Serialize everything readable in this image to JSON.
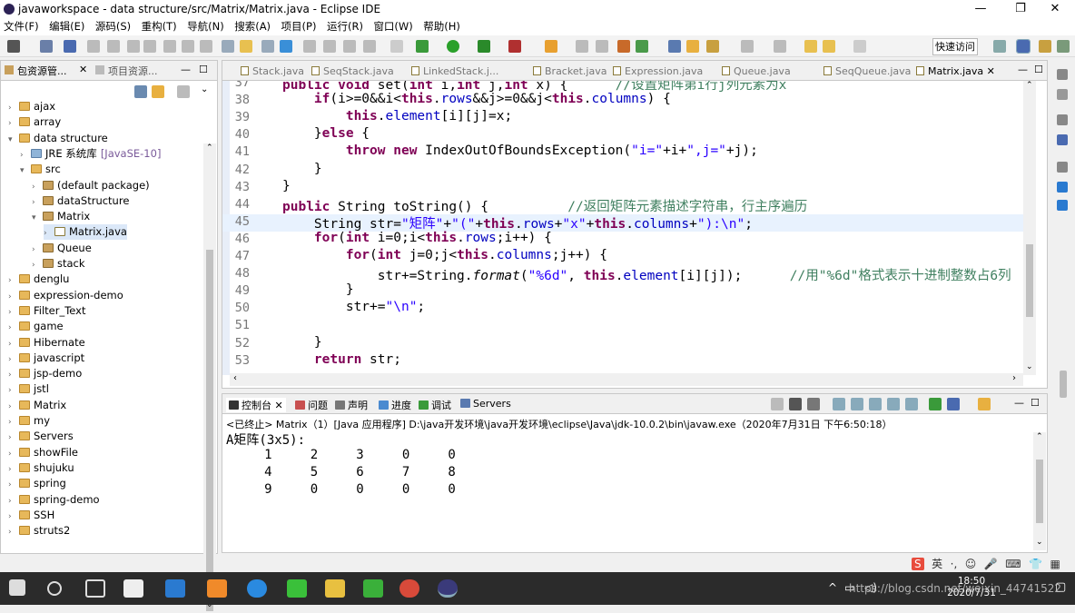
{
  "window": {
    "title": "javaworkspace - data structure/src/Matrix/Matrix.java - Eclipse IDE"
  },
  "menu": [
    "文件(F)",
    "编辑(E)",
    "源码(S)",
    "重构(T)",
    "导航(N)",
    "搜索(A)",
    "项目(P)",
    "运行(R)",
    "窗口(W)",
    "帮助(H)"
  ],
  "toolbar": {
    "quick_access": "快速访问"
  },
  "left_panel": {
    "tabs": [
      "包资源管...",
      "项目资源..."
    ],
    "tree": [
      {
        "label": "ajax",
        "type": "folder",
        "level": 0,
        "arrow": ">"
      },
      {
        "label": "array",
        "type": "folder",
        "level": 0,
        "arrow": ">"
      },
      {
        "label": "data structure",
        "type": "folder",
        "level": 0,
        "arrow": "v"
      },
      {
        "label": "JRE 系统库",
        "suffix": "[JavaSE-10]",
        "type": "lib",
        "level": 1,
        "arrow": ">"
      },
      {
        "label": "src",
        "type": "folder",
        "level": 1,
        "arrow": "v"
      },
      {
        "label": "(default package)",
        "type": "pkg",
        "level": 2,
        "arrow": ">"
      },
      {
        "label": "dataStructure",
        "type": "pkg",
        "level": 2,
        "arrow": ">"
      },
      {
        "label": "Matrix",
        "type": "pkg",
        "level": 2,
        "arrow": "v"
      },
      {
        "label": "Matrix.java",
        "type": "java",
        "level": 3,
        "arrow": ">"
      },
      {
        "label": "Queue",
        "type": "pkg",
        "level": 2,
        "arrow": ">"
      },
      {
        "label": "stack",
        "type": "pkg",
        "level": 2,
        "arrow": ">"
      },
      {
        "label": "denglu",
        "type": "folder",
        "level": 0,
        "arrow": ">"
      },
      {
        "label": "expression-demo",
        "type": "folder",
        "level": 0,
        "arrow": ">"
      },
      {
        "label": "Filter_Text",
        "type": "folder",
        "level": 0,
        "arrow": ">"
      },
      {
        "label": "game",
        "type": "folder",
        "level": 0,
        "arrow": ">"
      },
      {
        "label": "Hibernate",
        "type": "folder",
        "level": 0,
        "arrow": ">"
      },
      {
        "label": "javascript",
        "type": "folder",
        "level": 0,
        "arrow": ">"
      },
      {
        "label": "jsp-demo",
        "type": "folder",
        "level": 0,
        "arrow": ">"
      },
      {
        "label": "jstl",
        "type": "folder",
        "level": 0,
        "arrow": ">"
      },
      {
        "label": "Matrix",
        "type": "folder",
        "level": 0,
        "arrow": ">"
      },
      {
        "label": "my",
        "type": "folder",
        "level": 0,
        "arrow": ">"
      },
      {
        "label": "Servers",
        "type": "folder",
        "level": 0,
        "arrow": ">"
      },
      {
        "label": "showFile",
        "type": "folder",
        "level": 0,
        "arrow": ">"
      },
      {
        "label": "shujuku",
        "type": "folder",
        "level": 0,
        "arrow": ">"
      },
      {
        "label": "spring",
        "type": "folder",
        "level": 0,
        "arrow": ">"
      },
      {
        "label": "spring-demo",
        "type": "folder",
        "level": 0,
        "arrow": ">"
      },
      {
        "label": "SSH",
        "type": "folder",
        "level": 0,
        "arrow": ">"
      },
      {
        "label": "struts2",
        "type": "folder",
        "level": 0,
        "arrow": ">"
      }
    ]
  },
  "editor": {
    "tabs": [
      "Stack.java",
      "SeqStack.java",
      "LinkedStack.j...",
      "Bracket.java",
      "Expression.java",
      "Queue.java",
      "SeqQueue.java",
      "Matrix.java"
    ],
    "active_tab": "Matrix.java",
    "lines": [
      {
        "n": "37",
        "code": [
          [
            "kw",
            "public "
          ],
          [
            "kw",
            "void "
          ],
          [
            "",
            "set("
          ],
          [
            "kw",
            "int "
          ],
          [
            "",
            "i,"
          ],
          [
            "kw",
            "int "
          ],
          [
            "",
            "j,"
          ],
          [
            "kw",
            "int "
          ],
          [
            "",
            "x) {      "
          ],
          [
            "cm",
            "//设置矩阵第i行j列元素为x"
          ]
        ]
      },
      {
        "n": "38",
        "code": [
          [
            "",
            "    "
          ],
          [
            "kw",
            "if"
          ],
          [
            "",
            "(i>=0&&i<"
          ],
          [
            "kw",
            "this"
          ],
          [
            "",
            "."
          ],
          [
            "fld",
            "rows"
          ],
          [
            "",
            "&&j>=0&&j<"
          ],
          [
            "kw",
            "this"
          ],
          [
            "",
            "."
          ],
          [
            "fld",
            "columns"
          ],
          [
            "",
            ") {"
          ]
        ]
      },
      {
        "n": "39",
        "code": [
          [
            "",
            "        "
          ],
          [
            "kw",
            "this"
          ],
          [
            "",
            "."
          ],
          [
            "fld",
            "element"
          ],
          [
            "",
            "[i][j]=x;"
          ]
        ]
      },
      {
        "n": "40",
        "code": [
          [
            "",
            "    }"
          ],
          [
            "kw",
            "else"
          ],
          [
            "",
            " {"
          ]
        ]
      },
      {
        "n": "41",
        "code": [
          [
            "",
            "        "
          ],
          [
            "kw",
            "throw "
          ],
          [
            "kw",
            "new "
          ],
          [
            "",
            "IndexOutOfBoundsException("
          ],
          [
            "str",
            "\"i=\""
          ],
          [
            "",
            "+i+"
          ],
          [
            "str",
            "\",j=\""
          ],
          [
            "",
            "+j);"
          ]
        ]
      },
      {
        "n": "42",
        "code": [
          [
            "",
            "    }"
          ]
        ]
      },
      {
        "n": "43",
        "code": [
          [
            "",
            "}"
          ]
        ]
      },
      {
        "n": "44",
        "code": [
          [
            "kw",
            "public "
          ],
          [
            "",
            "String toString() {          "
          ],
          [
            "cm",
            "//返回矩阵元素描述字符串，行主序遍历"
          ]
        ]
      },
      {
        "n": "45",
        "code": [
          [
            "",
            "    String str="
          ],
          [
            "str",
            "\"矩阵\""
          ],
          [
            "",
            "+"
          ],
          [
            "str",
            "\"(\""
          ],
          [
            "",
            "+"
          ],
          [
            "kw",
            "this"
          ],
          [
            "",
            "."
          ],
          [
            "fld",
            "rows"
          ],
          [
            "",
            "+"
          ],
          [
            "str",
            "\"x\""
          ],
          [
            "",
            "+"
          ],
          [
            "kw",
            "this"
          ],
          [
            "",
            "."
          ],
          [
            "fld",
            "columns"
          ],
          [
            "",
            "+"
          ],
          [
            "str",
            "\"):\\n\""
          ],
          [
            "",
            ";"
          ]
        ]
      },
      {
        "n": "46",
        "code": [
          [
            "",
            "    "
          ],
          [
            "kw",
            "for"
          ],
          [
            "",
            "("
          ],
          [
            "kw",
            "int "
          ],
          [
            "",
            "i=0;i<"
          ],
          [
            "kw",
            "this"
          ],
          [
            "",
            "."
          ],
          [
            "fld",
            "rows"
          ],
          [
            "",
            ";i++) {"
          ]
        ]
      },
      {
        "n": "47",
        "code": [
          [
            "",
            "        "
          ],
          [
            "kw",
            "for"
          ],
          [
            "",
            "("
          ],
          [
            "kw",
            "int "
          ],
          [
            "",
            "j=0;j<"
          ],
          [
            "kw",
            "this"
          ],
          [
            "",
            "."
          ],
          [
            "fld",
            "columns"
          ],
          [
            "",
            ";j++) {"
          ]
        ]
      },
      {
        "n": "48",
        "code": [
          [
            "",
            "            str+=String."
          ],
          [
            "it",
            "format"
          ],
          [
            "",
            "("
          ],
          [
            "str",
            "\"%6d\""
          ],
          [
            "",
            ", "
          ],
          [
            "kw",
            "this"
          ],
          [
            "",
            "."
          ],
          [
            "fld",
            "element"
          ],
          [
            "",
            "[i][j]);      "
          ],
          [
            "cm",
            "//用\"%6d\"格式表示十进制整数占6列"
          ]
        ]
      },
      {
        "n": "49",
        "code": [
          [
            "",
            "        }"
          ]
        ]
      },
      {
        "n": "50",
        "code": [
          [
            "",
            "        str+="
          ],
          [
            "str",
            "\"\\n\""
          ],
          [
            "",
            ";"
          ]
        ]
      },
      {
        "n": "51",
        "code": []
      },
      {
        "n": "52",
        "code": [
          [
            "",
            "    }"
          ]
        ]
      },
      {
        "n": "53",
        "code": [
          [
            "",
            "    "
          ],
          [
            "kw",
            "return "
          ],
          [
            "",
            "str;"
          ]
        ]
      }
    ]
  },
  "console": {
    "tabs": [
      "控制台",
      "问题",
      "声明",
      "进度",
      "调试",
      "Servers"
    ],
    "info": "<已终止> Matrix（1）[Java 应用程序] D:\\java开发环境\\java开发环境\\eclipse\\Java\\jdk-10.0.2\\bin\\javaw.exe（2020年7月31日 下午6:50:18）",
    "output": [
      "A矩阵(3x5):",
      "     1     2     3     0     0",
      "     4     5     6     7     8",
      "     9     0     0     0     0"
    ]
  },
  "taskbar": {
    "time": "18:50",
    "date": "2020/7/31"
  },
  "ime": {
    "lang": "英"
  },
  "watermark": "https://blog.csdn.net/weixin_44741522"
}
